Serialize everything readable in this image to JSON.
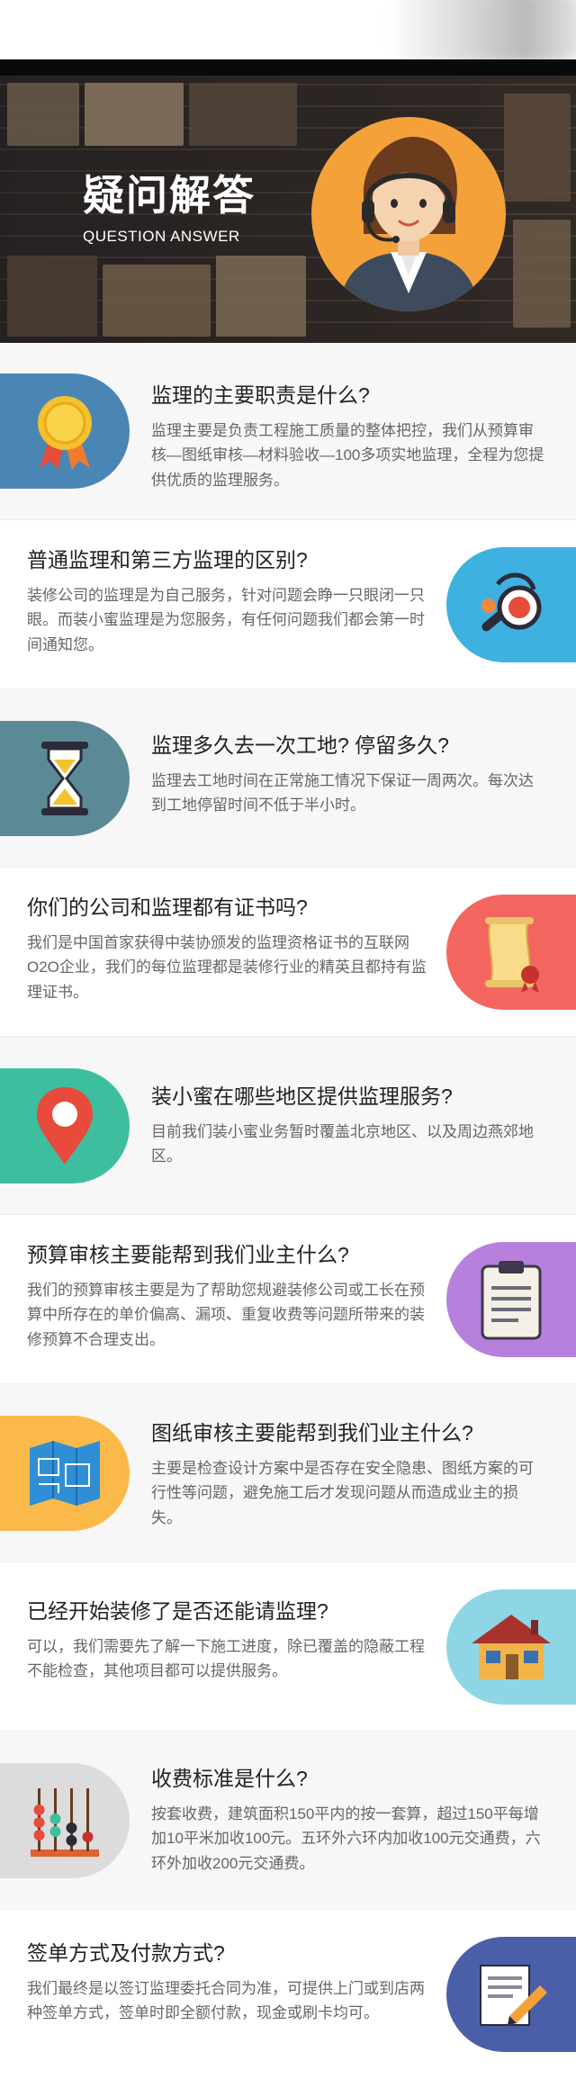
{
  "hero": {
    "title_cn": "疑问解答",
    "title_en": "QUESTION ANSWER"
  },
  "faqs": [
    {
      "question": "监理的主要职责是什么?",
      "answer": "监理主要是负责工程施工质量的整体把控，我们从预算审核—图纸审核—材料验收—100多项实地监理，全程为您提供优质的监理服务。",
      "icon": "medal-icon",
      "color": "#4a86b4"
    },
    {
      "question": "普通监理和第三方监理的区别?",
      "answer": "装修公司的监理是为自己服务，针对问题会睁一只眼闭一只眼。而装小蜜监理是为您服务，有任何问题我们都会第一时间通知您。",
      "icon": "magnifier-icon",
      "color": "#3fb1e0"
    },
    {
      "question": "监理多久去一次工地? 停留多久?",
      "answer": "监理去工地时间在正常施工情况下保证一周两次。每次达到工地停留时间不低于半小时。",
      "icon": "hourglass-icon",
      "color": "#5b8a96"
    },
    {
      "question": "你们的公司和监理都有证书吗?",
      "answer": "我们是中国首家获得中装协颁发的监理资格证书的互联网O2O企业，我们的每位监理都是装修行业的精英且都持有监理证书。",
      "icon": "certificate-scroll-icon",
      "color": "#f2665f"
    },
    {
      "question": "装小蜜在哪些地区提供监理服务?",
      "answer": "目前我们装小蜜业务暂时覆盖北京地区、以及周边燕郊地区。",
      "icon": "location-pin-icon",
      "color": "#3dbf9f"
    },
    {
      "question": "预算审核主要能帮到我们业主什么?",
      "answer": "我们的预算审核主要是为了帮助您规避装修公司或工长在预算中所存在的单价偏高、漏项、重复收费等问题所带来的装修预算不合理支出。",
      "icon": "clipboard-icon",
      "color": "#b780dc"
    },
    {
      "question": "图纸审核主要能帮到我们业主什么?",
      "answer": "主要是检查设计方案中是否存在安全隐患、图纸方案的可行性等问题，避免施工后才发现问题从而造成业主的损失。",
      "icon": "blueprint-map-icon",
      "color": "#fbb94a"
    },
    {
      "question": "已经开始装修了是否还能请监理?",
      "answer": "可以，我们需要先了解一下施工进度，除已覆盖的隐蔽工程不能检查，其他项目都可以提供服务。",
      "icon": "house-icon",
      "color": "#8ed6e6"
    },
    {
      "question": "收费标准是什么?",
      "answer": "按套收费，建筑面积150平内的按一套算，超过150平每增加10平米加收100元。五环外六环内加收100元交通费，六环外加收200元交通费。",
      "icon": "abacus-icon",
      "color": "#dcdcdc"
    },
    {
      "question": "签单方式及付款方式?",
      "answer": "我们最终是以签订监理委托合同为准，可提供上门或到店两种签单方式，签单时即全额付款，现金或刷卡均可。",
      "icon": "contract-pen-icon",
      "color": "#4b5fa8"
    }
  ]
}
